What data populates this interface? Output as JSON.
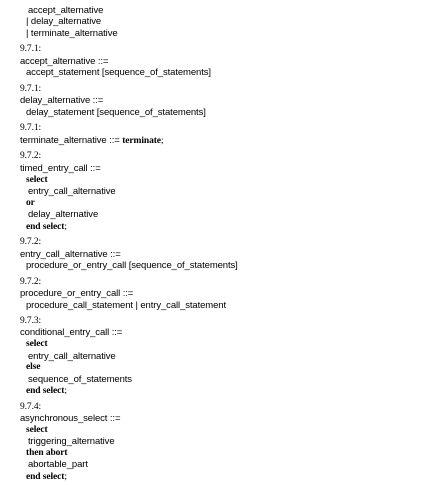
{
  "lines": {
    "l01": "accept_alternative",
    "l02": "| delay_alternative",
    "l03": "| terminate_alternative",
    "l04": "9.7.1:",
    "l05": "accept_alternative ::=",
    "l06": "accept_statement [sequence_of_statements]",
    "l07": "9.7.1:",
    "l08": "delay_alternative ::=",
    "l09": "delay_statement [sequence_of_statements]",
    "l10": "9.7.1:",
    "l11a": "terminate_alternative ::= ",
    "l11b": "terminate",
    "l11c": ";",
    "l12": "9.7.2:",
    "l13": "timed_entry_call ::=",
    "l14": "select",
    "l15": "entry_call_alternative",
    "l16": "or",
    "l17": "delay_alternative",
    "l18a": "end select",
    "l18b": ";",
    "l19": "9.7.2:",
    "l20": "entry_call_alternative ::=",
    "l21": "procedure_or_entry_call [sequence_of_statements]",
    "l22": "9.7.2:",
    "l23": "procedure_or_entry_call ::=",
    "l24": "procedure_call_statement | entry_call_statement",
    "l25": "9.7.3:",
    "l26": "conditional_entry_call ::=",
    "l27": "select",
    "l28": "entry_call_alternative",
    "l29": "else",
    "l30": "sequence_of_statements",
    "l31a": "end select",
    "l31b": ";",
    "l32": "9.7.4:",
    "l33": "asynchronous_select ::=",
    "l34": "select",
    "l35": "triggering_alternative",
    "l36": "then abort",
    "l37": "abortable_part",
    "l38a": "end select",
    "l38b": ";"
  }
}
